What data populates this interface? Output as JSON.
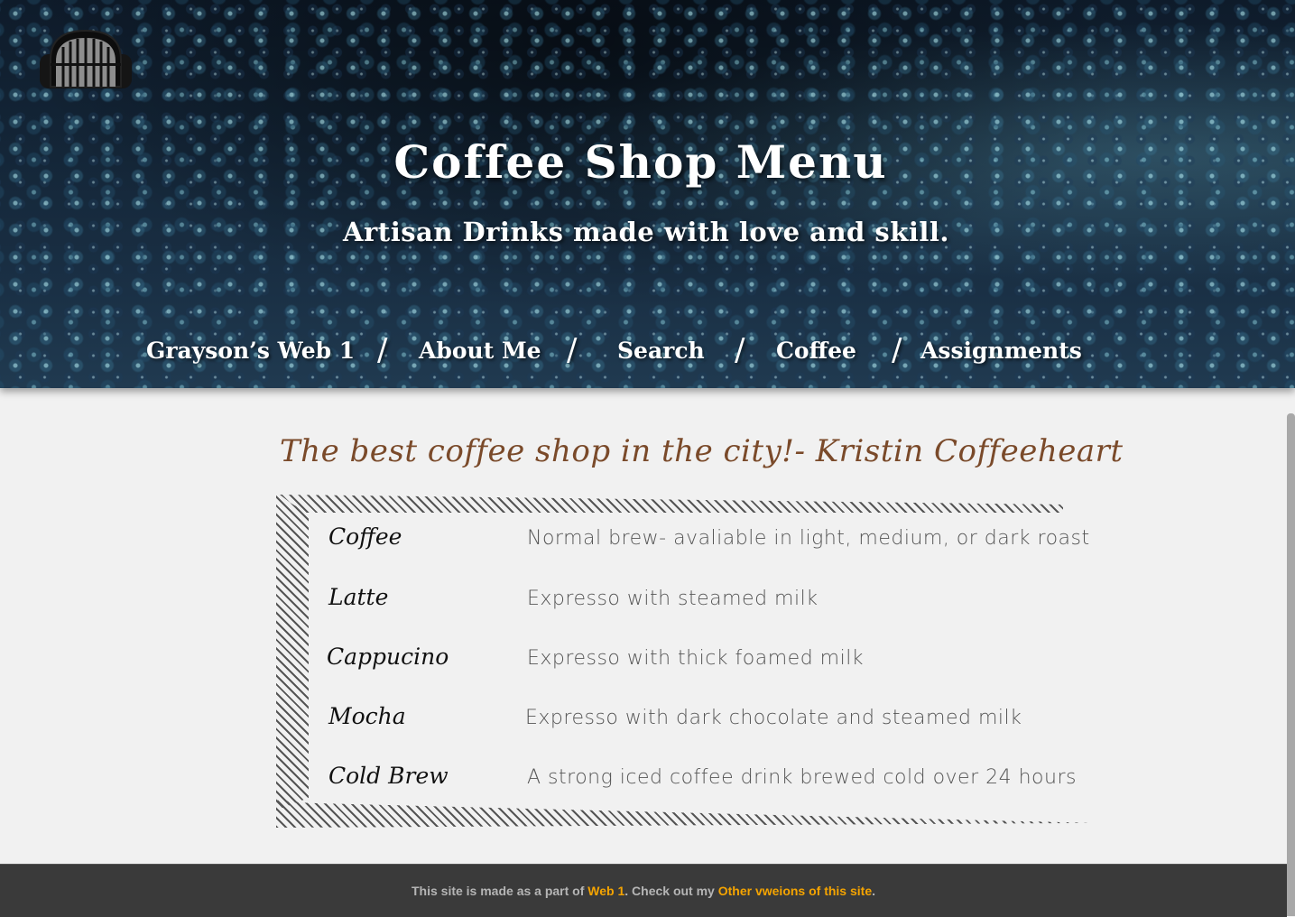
{
  "header": {
    "title": "Coffee Shop Menu",
    "subtitle": "Artisan Drinks made with love and skill."
  },
  "nav": {
    "items": [
      "Grayson’s Web 1",
      "About Me",
      "Search",
      "Coffee",
      "Assignments"
    ],
    "separator": "/"
  },
  "main": {
    "quote": "The best coffee shop in the city!- Kristin Coffeeheart",
    "menu": [
      {
        "name": "Coffee",
        "description": "Normal brew- avaliable in light, medium, or  dark roast"
      },
      {
        "name": "Latte",
        "description": "Expresso with steamed milk"
      },
      {
        "name": "Cappucino",
        "description": "Expresso with thick foamed milk"
      },
      {
        "name": "Mocha",
        "description": "Expresso with dark chocolate and steamed milk"
      },
      {
        "name": "Cold Brew",
        "description": "A strong iced coffee drink brewed cold over 24 hours"
      }
    ]
  },
  "footer": {
    "text_before": "This site is made as a part of ",
    "link1": "Web 1",
    "text_middle": ". Check out my ",
    "link2": "Other vweions of this site",
    "text_after": "."
  },
  "icons": {
    "logo": "birdcage-logo-icon"
  }
}
